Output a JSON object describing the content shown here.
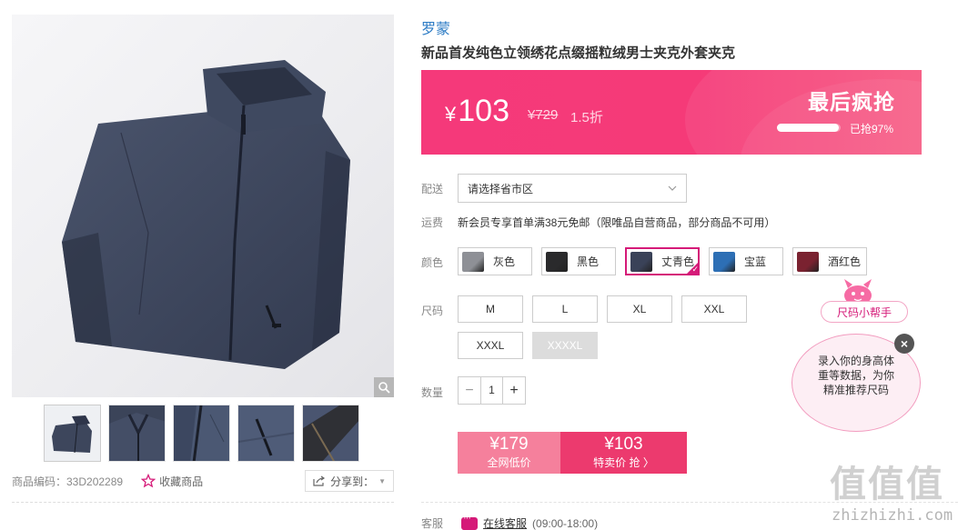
{
  "product": {
    "brand": "罗蒙",
    "title": "新品首发纯色立领绣花点缀摇粒绒男士夹克外套夹克"
  },
  "price_banner": {
    "currency": "¥",
    "price": "103",
    "original_price": "¥729",
    "discount": "1.5折",
    "promo_label": "最后疯抢",
    "sold_label": "已抢97%",
    "sold_progress": 0.97
  },
  "gallery": {
    "thumbnails": [
      "thumb-1",
      "thumb-2",
      "thumb-3",
      "thumb-4",
      "thumb-5"
    ]
  },
  "meta": {
    "sku_label": "商品编码：33D202289",
    "favorite_label": "收藏商品",
    "share_label": "分享到："
  },
  "delivery": {
    "label": "配送",
    "select_value": "请选择省市区"
  },
  "shipping": {
    "label": "运费",
    "text": "新会员专享首单满38元免邮（限唯品自营商品，部分商品不可用）"
  },
  "colors": {
    "label": "颜色",
    "options": [
      {
        "name": "灰色",
        "color": "#8e9096",
        "selected": false
      },
      {
        "name": "黑色",
        "color": "#2a2a2c",
        "selected": false
      },
      {
        "name": "丈青色",
        "color": "#3a4258",
        "selected": true
      },
      {
        "name": "宝蓝",
        "color": "#2d6fb5",
        "selected": false
      },
      {
        "name": "酒红色",
        "color": "#7a2230",
        "selected": false
      }
    ]
  },
  "sizes": {
    "label": "尺码",
    "options": [
      {
        "name": "M",
        "disabled": false
      },
      {
        "name": "L",
        "disabled": false
      },
      {
        "name": "XL",
        "disabled": false
      },
      {
        "name": "XXL",
        "disabled": false
      },
      {
        "name": "XXXL",
        "disabled": false
      },
      {
        "name": "XXXXL",
        "disabled": true
      }
    ]
  },
  "quantity": {
    "label": "数量",
    "value": "1",
    "minus": "−",
    "plus": "+"
  },
  "buy": {
    "market_price": "¥179",
    "market_label": "全网低价",
    "special_price": "¥103",
    "special_label": "特卖价 抢 〉"
  },
  "service": {
    "label": "客服",
    "link_text": "在线客服",
    "hours": "(09:00-18:00)"
  },
  "size_helper": {
    "pill_label": "尺码小帮手",
    "bubble_line1": "录入你的身高体",
    "bubble_line2": "重等数据，为你",
    "bubble_line3": "精准推荐尺码",
    "close_glyph": "×"
  },
  "watermark": {
    "logo": "值值值",
    "url": "zhizhizhi.com"
  },
  "theme": {
    "accent": "#d51a78",
    "banner": "#f5397a",
    "brand_link": "#2a7ac4"
  }
}
